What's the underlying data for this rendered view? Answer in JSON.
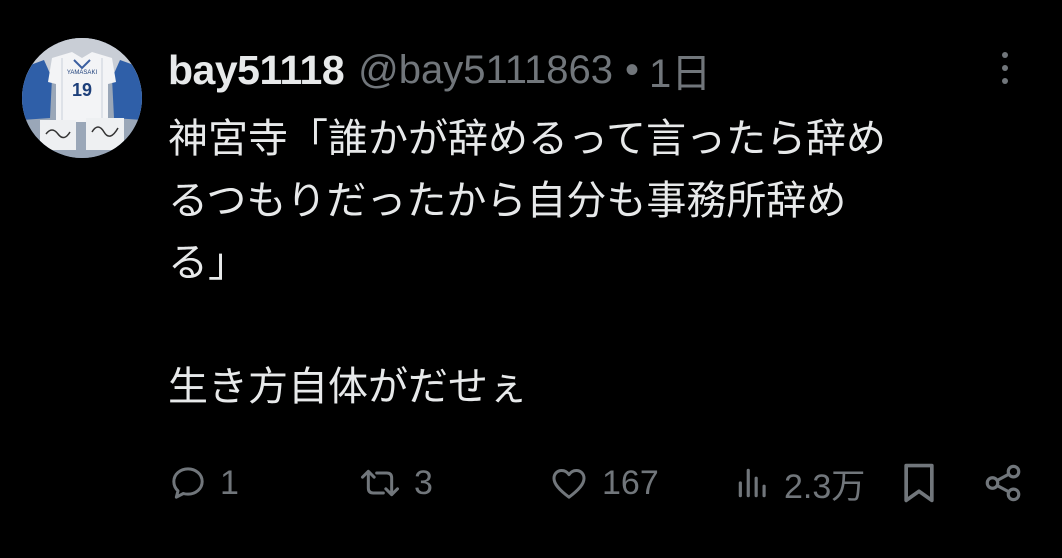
{
  "tweet": {
    "display_name": "bay51118",
    "handle": "@bay5111863",
    "separator": "•",
    "time": "1日",
    "avatar_icon": "avatar-image",
    "more_icon": "more-dots-icon",
    "body_lines": [
      "神宮寺「誰かが辞めるって言ったら辞め",
      "るつもりだったから自分も事務所辞め",
      "る」",
      "生き方自体がだせぇ"
    ]
  },
  "actions": {
    "reply": {
      "icon": "reply-icon",
      "count": "1"
    },
    "retweet": {
      "icon": "retweet-icon",
      "count": "3"
    },
    "like": {
      "icon": "heart-icon",
      "count": "167"
    },
    "views": {
      "icon": "views-icon",
      "count": "2.3万"
    },
    "bookmark": {
      "icon": "bookmark-icon"
    },
    "share": {
      "icon": "share-icon"
    }
  },
  "colors": {
    "background": "#000000",
    "primary_text": "#e7e9ea",
    "secondary_text": "#71767b"
  }
}
